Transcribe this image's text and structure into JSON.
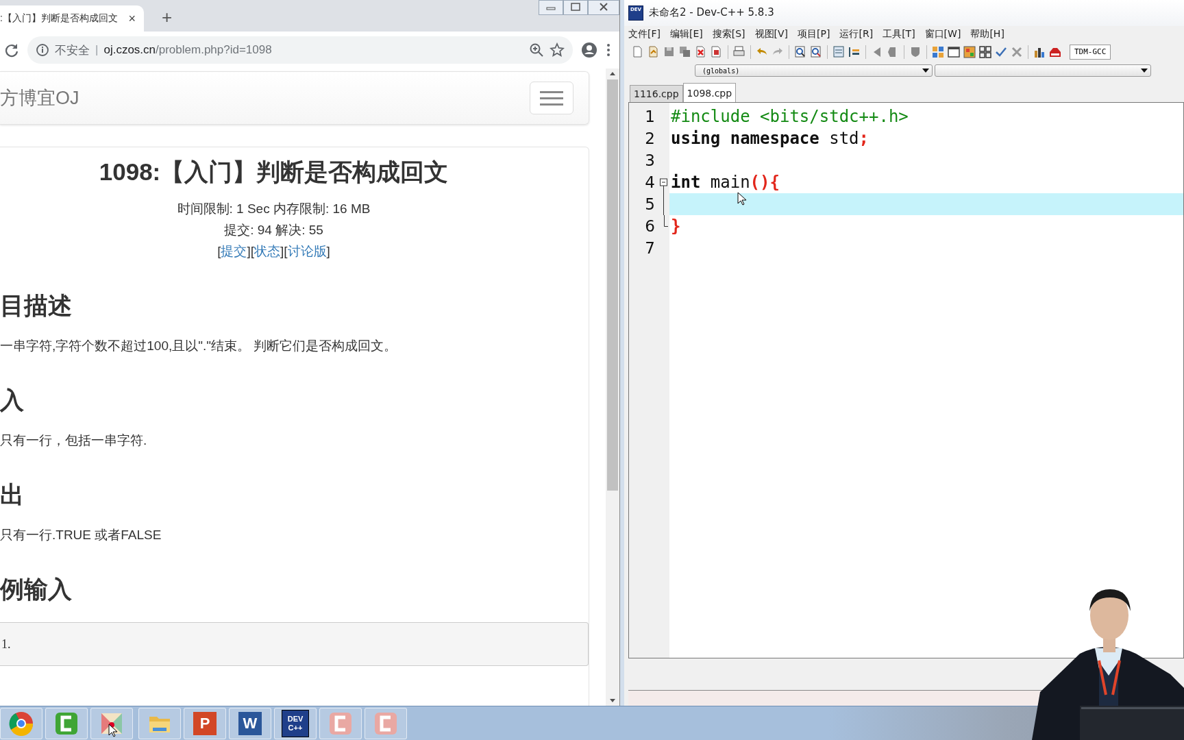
{
  "browser": {
    "tab": {
      "title": ":【入门】判断是否构成回文",
      "close": "×"
    },
    "new_tab": "+",
    "address": {
      "security": "不安全",
      "separator": "|",
      "host": "oj.czos.cn",
      "path": "/problem.php?id=1098"
    },
    "site": {
      "brand": "方博宜OJ"
    },
    "problem": {
      "title": "1098:【入门】判断是否构成回文",
      "limits": "时间限制: 1 Sec  内存限制: 16 MB",
      "stats": "提交: 94  解决: 55",
      "brackets": [
        "[",
        "]"
      ],
      "links": [
        "提交",
        "状态",
        "讨论版"
      ]
    },
    "sections": [
      {
        "heading": "目描述",
        "text": "一串字符,字符个数不超过100,且以\".\"结束。 判断它们是否构成回文。"
      },
      {
        "heading": "入",
        "text": "只有一行，包括一串字符."
      },
      {
        "heading": "出",
        "text": "只有一行.TRUE 或者FALSE"
      },
      {
        "heading": "例输入",
        "sample": "1."
      }
    ]
  },
  "ide": {
    "logo": "DEV",
    "title": "未命名2 - Dev-C++ 5.8.3",
    "menus": [
      "文件[F]",
      "编辑[E]",
      "搜索[S]",
      "视图[V]",
      "项目[P]",
      "运行[R]",
      "工具[T]",
      "窗口[W]",
      "帮助[H]"
    ],
    "compiler": "TDM-GCC",
    "class_select": "(globals)",
    "tabs": [
      {
        "label": "1116.cpp",
        "selected": false
      },
      {
        "label": "1098.cpp",
        "selected": true
      }
    ],
    "code": [
      {
        "number": "1",
        "current": false,
        "fold_marker": false,
        "fold_bar": false,
        "fold_end": false,
        "tokens": [
          {
            "kind": "preproc",
            "text": "#include <bits/stdc++.h>"
          }
        ]
      },
      {
        "number": "2",
        "current": false,
        "fold_marker": false,
        "fold_bar": false,
        "fold_end": false,
        "tokens": [
          {
            "kind": "keyword",
            "text": "using"
          },
          {
            "kind": "keyword",
            "text": " namespace"
          },
          {
            "kind": "plain",
            "text": " std"
          },
          {
            "kind": "symbol",
            "text": ";"
          }
        ]
      },
      {
        "number": "3",
        "current": false,
        "fold_marker": false,
        "fold_bar": false,
        "fold_end": false
      },
      {
        "number": "4",
        "current": false,
        "fold_marker": true,
        "fold_bar": false,
        "fold_end": false,
        "tokens": [
          {
            "kind": "keyword",
            "text": "int"
          },
          {
            "kind": "plain",
            "text": " main"
          },
          {
            "kind": "symbol",
            "text": "(){"
          }
        ]
      },
      {
        "number": "5",
        "current": true,
        "fold_marker": false,
        "fold_bar": true,
        "fold_end": false
      },
      {
        "number": "6",
        "current": false,
        "fold_marker": false,
        "fold_bar": false,
        "fold_end": true,
        "tokens": [
          {
            "kind": "symbol",
            "text": "}"
          }
        ]
      },
      {
        "number": "7",
        "current": false,
        "fold_marker": false,
        "fold_bar": false,
        "fold_end": false
      }
    ]
  },
  "taskbar": [
    {
      "kind": "browser"
    },
    {
      "kind": "recorder"
    },
    {
      "kind": "paint"
    },
    {
      "kind": "folder"
    },
    {
      "kind": "slides",
      "label": "P"
    },
    {
      "kind": "writer",
      "label": "W"
    },
    {
      "kind": "ide",
      "label": "DEV\nC++"
    },
    {
      "kind": "recorder-faded"
    },
    {
      "kind": "recorder-faded"
    }
  ]
}
